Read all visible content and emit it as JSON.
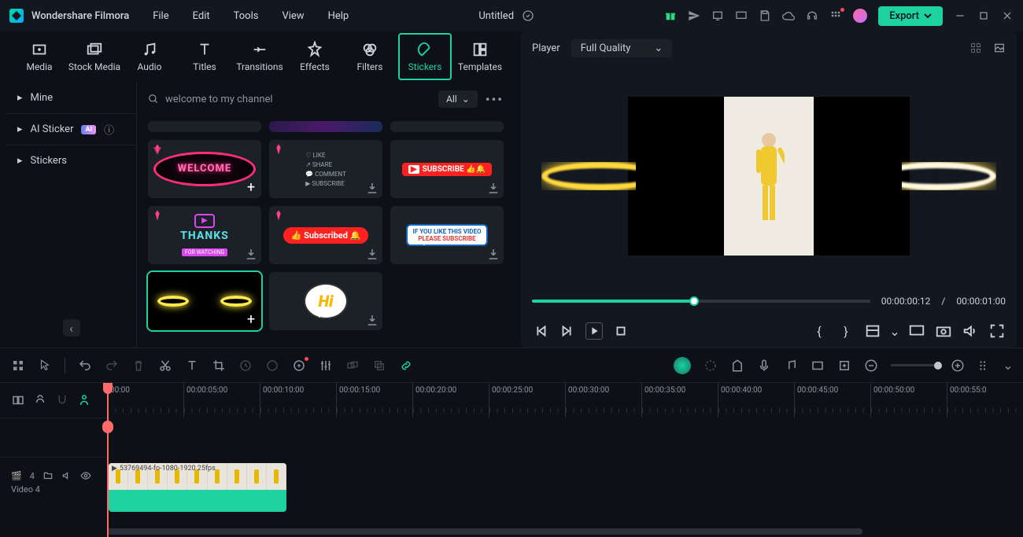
{
  "app": {
    "name": "Wondershare Filmora",
    "title": "Untitled"
  },
  "menu": [
    "File",
    "Edit",
    "Tools",
    "View",
    "Help"
  ],
  "export_label": "Export",
  "tabs": [
    {
      "id": "media",
      "label": "Media"
    },
    {
      "id": "stock",
      "label": "Stock Media"
    },
    {
      "id": "audio",
      "label": "Audio"
    },
    {
      "id": "titles",
      "label": "Titles"
    },
    {
      "id": "transitions",
      "label": "Transitions"
    },
    {
      "id": "effects",
      "label": "Effects"
    },
    {
      "id": "filters",
      "label": "Filters"
    },
    {
      "id": "stickers",
      "label": "Stickers"
    },
    {
      "id": "templates",
      "label": "Templates"
    }
  ],
  "active_tab": "stickers",
  "sidebar": [
    "Mine",
    "AI Sticker",
    "Stickers"
  ],
  "search": {
    "value": "welcome to my channel",
    "filter": "All"
  },
  "social_labels": [
    "LIKE",
    "SHARE",
    "COMMENT",
    "SUBSCRIBE"
  ],
  "player": {
    "label": "Player",
    "quality": "Full Quality",
    "time_cur": "00:00:00:12",
    "time_sep": "/",
    "time_tot": "00:00:01:00"
  },
  "ruler": [
    "00:00",
    "00:00:05:00",
    "00:00:10:00",
    "00:00:15:00",
    "00:00:20:00",
    "00:00:25:00",
    "00:00:30:00",
    "00:00:35:00",
    "00:00:40:00",
    "00:00:45:00",
    "00:00:50:00",
    "00:00:55:0"
  ],
  "track": {
    "badge": "4",
    "name": "Video 4"
  },
  "clip_label": "53769494-fo-1080-1920 25fps"
}
